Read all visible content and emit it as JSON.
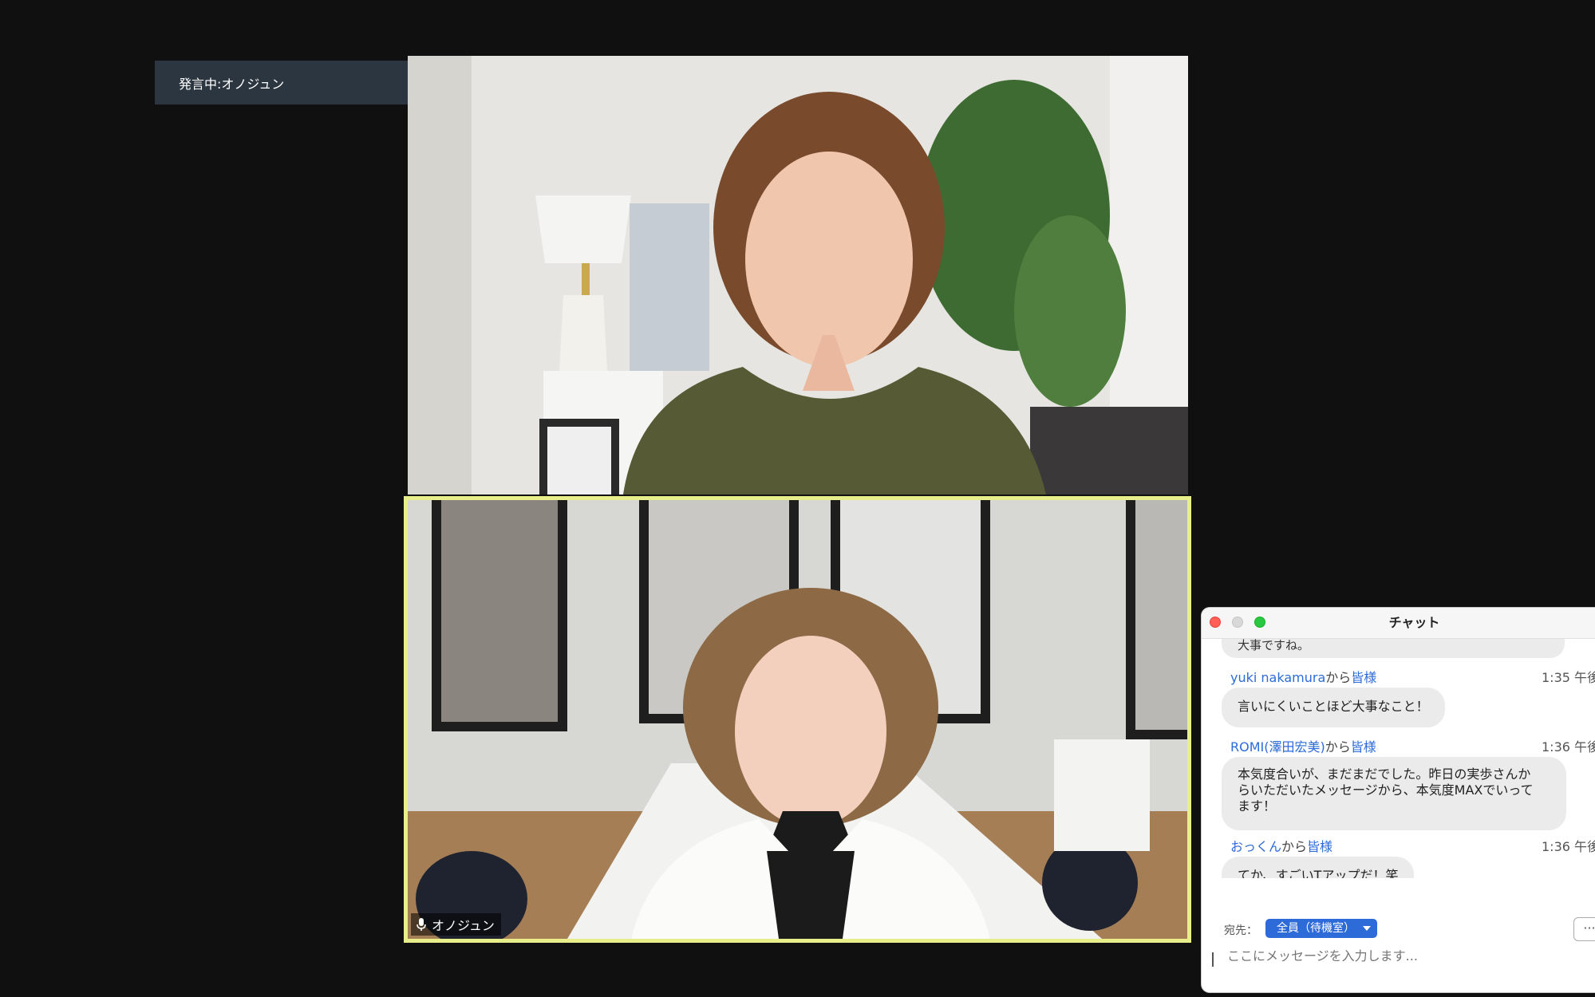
{
  "speaker_label": "発言中:オノジュン",
  "tiles": {
    "bottom_name": "オノジュン"
  },
  "chat": {
    "title": "チャット",
    "cut_message": "大事ですね。",
    "messages": [
      {
        "sender": "yuki nakamura",
        "from_word": "から",
        "target": "皆様",
        "time": "1:35 午後",
        "text": "言いにくいことほど大事なこと！"
      },
      {
        "sender": "ROMI(澤田宏美)",
        "from_word": "から",
        "target": "皆様",
        "time": "1:36 午後",
        "text_lines": [
          "本気度合いが、まだまだでした。昨日の実歩さんか",
          "らいただいたメッセージから、本気度MAXでいって",
          "ます！"
        ]
      },
      {
        "sender": "おっくん",
        "from_word": "から",
        "target": "皆様",
        "time": "1:36 午後",
        "text": "てか、すごいTアップだ！笑"
      }
    ],
    "to_label": "宛先：",
    "to_value": "全員（待機室）",
    "more_label": "···",
    "input_placeholder": "ここにメッセージを入力します..."
  },
  "colors": {
    "background": "#101010",
    "active_speaker_border": "#e8ee8a",
    "chat_link": "#2d6bd8"
  }
}
